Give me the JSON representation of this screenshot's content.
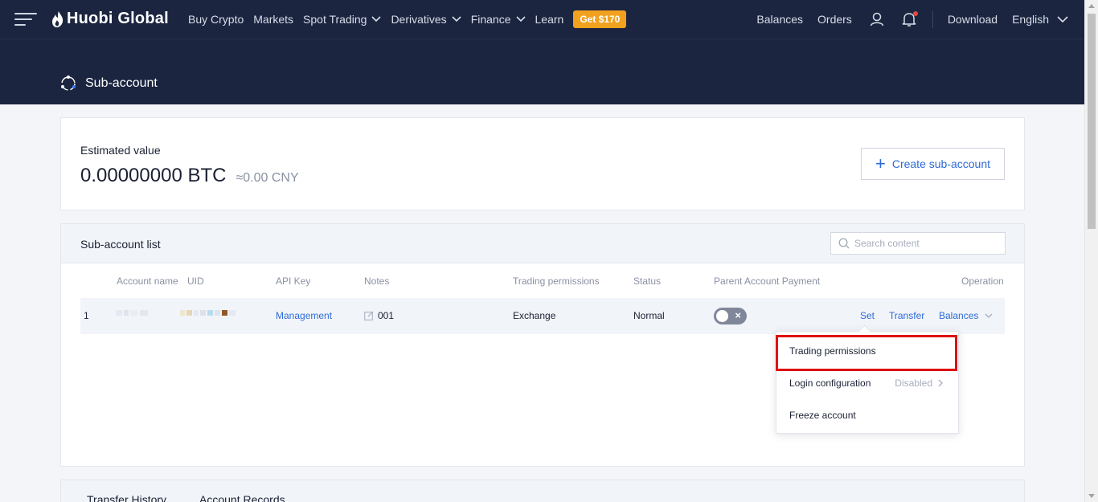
{
  "nav": {
    "brand": "Huobi Global",
    "items": [
      {
        "label": "Buy Crypto",
        "dropdown": false
      },
      {
        "label": "Markets",
        "dropdown": false
      },
      {
        "label": "Spot Trading",
        "dropdown": true
      },
      {
        "label": "Derivatives",
        "dropdown": true
      },
      {
        "label": "Finance",
        "dropdown": true
      },
      {
        "label": "Learn",
        "dropdown": false
      }
    ],
    "promo": "Get $170",
    "right": {
      "balances": "Balances",
      "orders": "Orders",
      "download": "Download",
      "language": "English"
    }
  },
  "page": {
    "title": "Sub-account"
  },
  "estimate": {
    "label": "Estimated value",
    "btc": "0.00000000 BTC",
    "cny": "≈0.00 CNY",
    "create_button": "Create sub-account"
  },
  "list": {
    "title": "Sub-account list",
    "search_placeholder": "Search content",
    "columns": {
      "account_name": "Account name",
      "uid": "UID",
      "api_key": "API Key",
      "notes": "Notes",
      "trading_permissions": "Trading permissions",
      "status": "Status",
      "parent_payment": "Parent Account Payment",
      "operation": "Operation"
    },
    "rows": [
      {
        "index": "1",
        "api_key": "Management",
        "notes": "001",
        "trading_permissions": "Exchange",
        "status": "Normal",
        "ops": {
          "set": "Set",
          "transfer": "Transfer",
          "balances": "Balances"
        }
      }
    ]
  },
  "dropdown": {
    "trading_permissions": "Trading permissions",
    "login_configuration": "Login configuration",
    "login_status": "Disabled",
    "freeze_account": "Freeze account"
  },
  "history": {
    "tabs": [
      "Transfer History",
      "Account Records"
    ]
  },
  "colors": {
    "nav_bg": "#1b2540",
    "accent": "#2d6ad9",
    "promo": "#f2a11e",
    "highlight": "#e01010"
  }
}
